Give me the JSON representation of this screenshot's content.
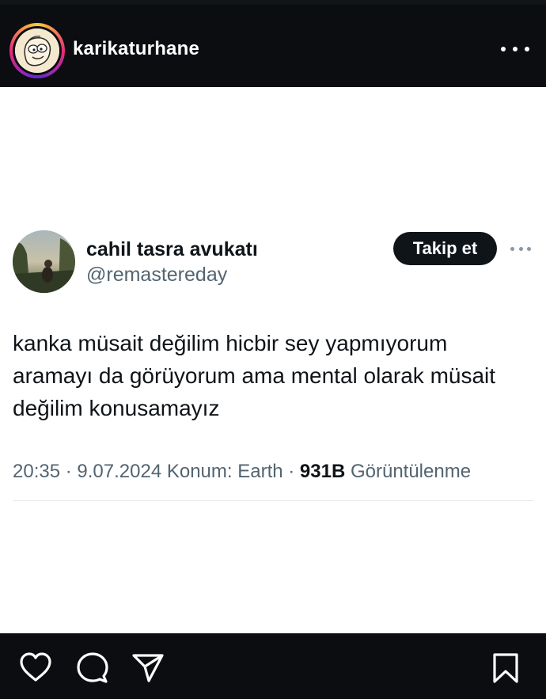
{
  "header": {
    "username": "karikaturhane",
    "avatar_icon": "cartoon-face-avatar",
    "more_icon": "more-horizontal-icon"
  },
  "tweet": {
    "display_name": "cahil tasra avukatı",
    "handle": "@remastereday",
    "follow_label": "Takip et",
    "text_lines": [
      "kanka müsait değilim hicbir sey yapmıyorum",
      "aramayı da görüyorum ama mental olarak müsait",
      "değilim konusamayız"
    ],
    "meta": {
      "time": "20:35",
      "sep1": " · ",
      "date": "9.07.2024",
      "location": " Konum: Earth",
      "sep2": " · ",
      "views_count": "931B",
      "views_label": " Görüntülenme"
    }
  },
  "actions": {
    "like_icon": "heart-icon",
    "comment_icon": "comment-icon",
    "share_icon": "send-icon",
    "save_icon": "bookmark-icon"
  },
  "colors": {
    "bar_background": "#0b0d10",
    "post_background": "#ffffff",
    "text_primary": "#0f1419",
    "text_secondary": "#536471",
    "follow_button": "#0f1419"
  }
}
